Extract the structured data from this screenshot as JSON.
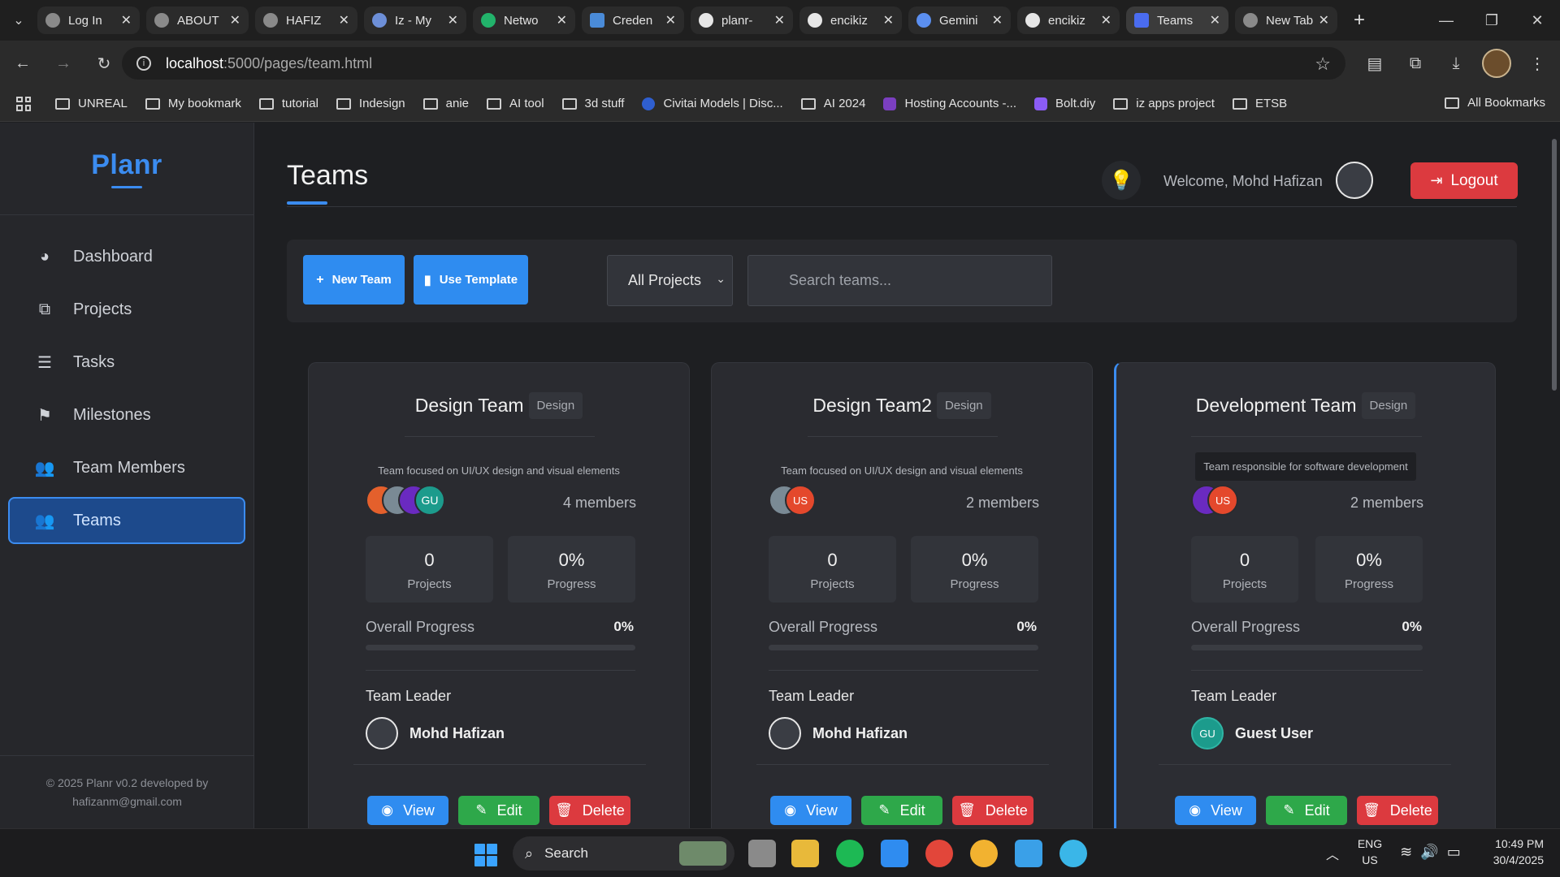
{
  "browser": {
    "tabs": [
      {
        "title": "Log In",
        "icon": "globe-icon",
        "color": "#8a8a8a"
      },
      {
        "title": "ABOUT",
        "icon": "globe-icon",
        "color": "#8a8a8a"
      },
      {
        "title": "HAFIZ",
        "icon": "globe-icon",
        "color": "#8a8a8a"
      },
      {
        "title": "Iz - My",
        "icon": "list-icon",
        "color": "#6d8fd8"
      },
      {
        "title": "Netwo",
        "icon": "leaf-icon",
        "color": "#22b36b"
      },
      {
        "title": "Creden",
        "icon": "api-icon",
        "color": "#4a8bd8"
      },
      {
        "title": "planr-",
        "icon": "triangle-icon",
        "color": "#e6e6e6"
      },
      {
        "title": "encikiz",
        "icon": "github-icon",
        "color": "#e6e6e6"
      },
      {
        "title": "Gemini",
        "icon": "sparkle-icon",
        "color": "#5b8ff0"
      },
      {
        "title": "encikiz",
        "icon": "github-icon",
        "color": "#e6e6e6"
      },
      {
        "title": "Teams",
        "icon": "p-icon",
        "color": "#4a6cf0",
        "active": true
      },
      {
        "title": "New Tab",
        "icon": "chrome-icon",
        "color": "#8a8a8a"
      }
    ],
    "url_host": "localhost",
    "url_path": ":5000/pages/team.html",
    "bookmarks": [
      "UNREAL",
      "My bookmark",
      "tutorial",
      "Indesign",
      "anie",
      "AI tool",
      "3d stuff",
      "Civitai Models | Disc...",
      "AI 2024",
      "Hosting Accounts -...",
      "Bolt.diy",
      "iz apps project",
      "ETSB"
    ],
    "all_bookmarks": "All Bookmarks"
  },
  "sidebar": {
    "logo": "Planr",
    "items": [
      {
        "label": "Dashboard",
        "icon": "pie-chart-icon"
      },
      {
        "label": "Projects",
        "icon": "project-diagram-icon"
      },
      {
        "label": "Tasks",
        "icon": "tasks-list-icon"
      },
      {
        "label": "Milestones",
        "icon": "flag-icon"
      },
      {
        "label": "Team Members",
        "icon": "users-icon"
      },
      {
        "label": "Teams",
        "icon": "users-group-icon",
        "active": true
      }
    ],
    "footer": "© 2025 Planr v0.2 developed by hafizanm@gmail.com"
  },
  "header": {
    "title": "Teams",
    "welcome": "Welcome, Mohd Hafizan",
    "logout": "Logout"
  },
  "filters": {
    "new_team": "New Team",
    "use_template": "Use Template",
    "project_select": "All Projects",
    "search_placeholder": "Search teams..."
  },
  "teams": [
    {
      "name": "Design Team",
      "tag": "Design",
      "description": "Team focused on UI/UX design and visual elements",
      "members": "4 members",
      "projects": "0",
      "projects_label": "Projects",
      "progress": "0%",
      "progress_label": "Progress",
      "overall_label": "Overall Progress",
      "overall": "0%",
      "overall_fraction": 0,
      "leader_label": "Team Leader",
      "leader": "Mohd Hafizan",
      "view": "View",
      "edit": "Edit",
      "delete": "Delete"
    },
    {
      "name": "Design Team2",
      "tag": "Design",
      "description": "Team focused on UI/UX design and visual elements",
      "members": "2 members",
      "projects": "0",
      "projects_label": "Projects",
      "progress": "0%",
      "progress_label": "Progress",
      "overall_label": "Overall Progress",
      "overall": "0%",
      "overall_fraction": 0,
      "leader_label": "Team Leader",
      "leader": "Mohd Hafizan",
      "view": "View",
      "edit": "Edit",
      "delete": "Delete"
    },
    {
      "name": "Development Team",
      "tag": "Design",
      "description": "Team responsible for software development",
      "members": "2 members",
      "projects": "0",
      "projects_label": "Projects",
      "progress": "0%",
      "progress_label": "Progress",
      "overall_label": "Overall Progress",
      "overall": "0%",
      "overall_fraction": 0,
      "leader_label": "Team Leader",
      "leader": "Guest User",
      "leader_initials": "GU",
      "view": "View",
      "edit": "Edit",
      "delete": "Delete"
    }
  ],
  "avatar_labels": {
    "gu": "GU",
    "us": "US"
  },
  "taskbar": {
    "search": "Search",
    "lang_1": "ENG",
    "lang_2": "US",
    "time": "10:49 PM",
    "date": "30/4/2025"
  },
  "colors": {
    "accent": "#3b8cf0",
    "danger": "#dc3a3f",
    "success": "#2ea84a"
  }
}
